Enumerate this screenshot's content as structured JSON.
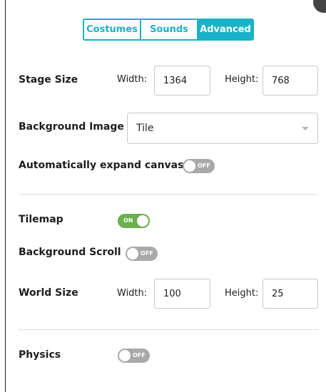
{
  "tabs": [
    {
      "label": "Costumes",
      "active": false
    },
    {
      "label": "Sounds",
      "active": false
    },
    {
      "label": "Advanced",
      "active": true
    }
  ],
  "stage_size": {
    "label": "Stage Size",
    "width_label": "Width:",
    "width_value": "1364",
    "height_label": "Height:",
    "height_value": "768"
  },
  "background_image": {
    "label": "Background Image",
    "selected": "Tile"
  },
  "auto_expand": {
    "label": "Automatically expand canvas",
    "state": "OFF"
  },
  "tilemap": {
    "label": "Tilemap",
    "state": "ON"
  },
  "background_scroll": {
    "label": "Background Scroll",
    "state": "OFF"
  },
  "world_size": {
    "label": "World Size",
    "width_label": "Width:",
    "width_value": "100",
    "height_label": "Height:",
    "height_value": "25"
  },
  "physics": {
    "label": "Physics",
    "state": "OFF"
  },
  "colors": {
    "accent": "#1ab2c6",
    "toggle_on": "#6ab04c",
    "toggle_off": "#a9a9a9"
  }
}
